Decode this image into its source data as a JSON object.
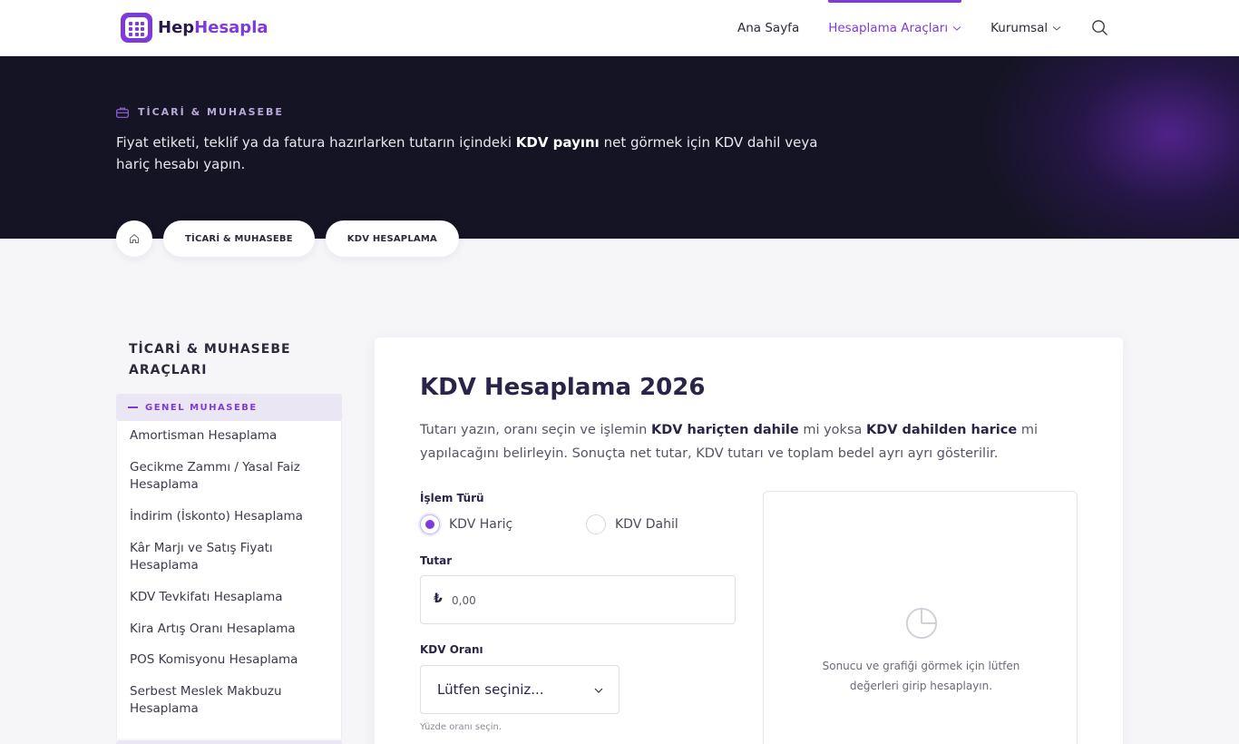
{
  "header": {
    "logo_part1": "Hep",
    "logo_part2": "Hesapla",
    "nav": {
      "home": "Ana Sayfa",
      "tools": "Hesaplama Araçları",
      "corporate": "Kurumsal"
    }
  },
  "hero": {
    "category": "TİCARİ & MUHASEBE",
    "desc_before": "Fiyat etiketi, teklif ya da fatura hazırlarken tutarın içindeki ",
    "desc_bold": "KDV payını",
    "desc_after": " net görmek için KDV dahil veya hariç hesabı yapın."
  },
  "breadcrumb": {
    "items": [
      "TİCARİ & MUHASEBE",
      "KDV HESAPLAMA"
    ]
  },
  "sidebar": {
    "title": "TİCARİ & MUHASEBE ARAÇLARI",
    "group": "GENEL MUHASEBE",
    "items": [
      "Amortisman Hesaplama",
      "Gecikme Zammı / Yasal Faiz Hesaplama",
      "İndirim (İskonto) Hesaplama",
      "Kâr Marjı ve Satış Fiyatı Hesaplama",
      "KDV Tevkifatı Hesaplama",
      "Kira Artış Oranı Hesaplama",
      "POS Komisyonu Hesaplama",
      "Serbest Meslek Makbuzu Hesaplama"
    ]
  },
  "main": {
    "title": "KDV Hesaplama 2026",
    "desc": {
      "p1": "Tutarı yazın, oranı seçin ve işlemin ",
      "b1": "KDV hariçten dahile",
      "p2": " mi yoksa ",
      "b2": "KDV dahilden harice",
      "p3": " mi yapılacağını belirleyin. Sonuçta net tutar, KDV tutarı ve toplam bedel ayrı ayrı gösterilir."
    },
    "form": {
      "operation_label": "İşlem Türü",
      "option_exclusive": "KDV Hariç",
      "option_inclusive": "KDV Dahil",
      "selected_option": "KDV Hariç",
      "amount_label": "Tutar",
      "currency_symbol": "₺",
      "amount_placeholder": "0,00",
      "rate_label": "KDV Oranı",
      "rate_selected": "Lütfen seçiniz...",
      "rate_hint": "Yüzde oranı seçin."
    },
    "result": {
      "empty_text": "Sonucu ve grafiği görmek için lütfen değerleri girip hesaplayın."
    }
  },
  "colors": {
    "accent": "#7e3bd9",
    "hero_bg": "#151424",
    "page_bg": "#f6f6f9"
  },
  "icons": [
    "calculator-logo-icon",
    "chevron-down-icon",
    "search-icon",
    "briefcase-icon",
    "home-icon",
    "pie-chart-icon"
  ]
}
